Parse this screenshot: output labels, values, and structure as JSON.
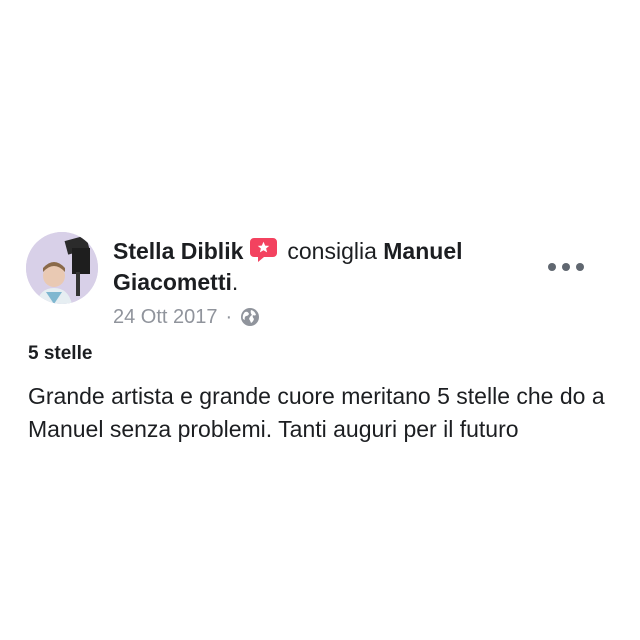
{
  "post": {
    "author": "Stella Diblik",
    "verb": "consiglia",
    "target": "Manuel Giacometti",
    "target_suffix": ".",
    "date": "24 Ott 2017",
    "separator": "·",
    "privacy_icon": "globe-icon",
    "recommend_icon": "recommend-badge-icon",
    "more_icon": "more-options-icon",
    "rating_label": "5 stelle",
    "review_text": "Grande artista e grande cuore meritano 5 stelle che do a Manuel senza problemi. Tanti auguri per il futuro"
  },
  "colors": {
    "recommend_red": "#f3425f",
    "meta_gray": "#90949c",
    "text": "#1c1e21"
  }
}
